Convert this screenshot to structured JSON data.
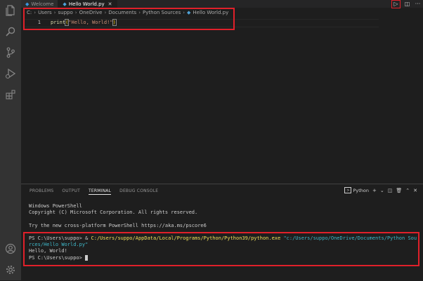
{
  "tabs": [
    {
      "label": "Welcome",
      "active": false
    },
    {
      "label": "Hello World.py",
      "active": true
    }
  ],
  "breadcrumb": [
    "C:",
    "Users",
    "suppo",
    "OneDrive",
    "Documents",
    "Python Sources",
    "Hello World.py"
  ],
  "editor": {
    "line_number": "1",
    "code_fn": "print",
    "code_open": "(",
    "code_str": "\"Hello, World!\"",
    "code_close": ")"
  },
  "panel": {
    "tabs": [
      "PROBLEMS",
      "OUTPUT",
      "TERMINAL",
      "DEBUG CONSOLE"
    ],
    "active_tab": "TERMINAL",
    "terminal_shell": "Python"
  },
  "terminal": {
    "line1": "Windows PowerShell",
    "line2": "Copyright (C) Microsoft Corporation. All rights reserved.",
    "line3": "Try the new cross-platform PowerShell https://aka.ms/pscore6",
    "prompt": "PS C:\\Users\\suppo> ",
    "cmd_amp": "& ",
    "cmd_exe": "C:/Users/suppo/AppData/Local/Programs/Python/Python39/python.exe",
    "cmd_arg1": " \"c:/Users/suppo/OneDrive/Documents/Python Sou",
    "cmd_arg2": "rces/Hello World.py\"",
    "output": "Hello, World!",
    "prompt2": "PS C:\\Users\\suppo> "
  },
  "colors": {
    "highlight": "#e0202a",
    "background": "#1e1e1e",
    "activity_bar": "#333333",
    "python_icon": "#4fa3d8"
  }
}
